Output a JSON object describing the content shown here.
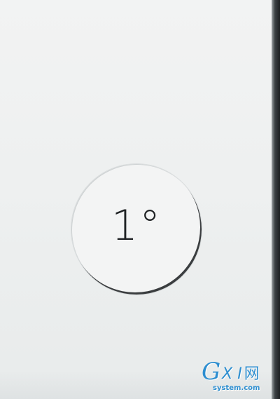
{
  "level": {
    "value": "1°"
  },
  "watermark": {
    "logo_g": "G",
    "logo_xi": "X I",
    "logo_net": "网",
    "domain": "system.com"
  },
  "colors": {
    "background": "#eef0f0",
    "dial_fill": "#f3f4f4",
    "dial_rim": "#3a3d3f",
    "value_text": "#1f2224",
    "watermark": "#2d8ed0"
  }
}
